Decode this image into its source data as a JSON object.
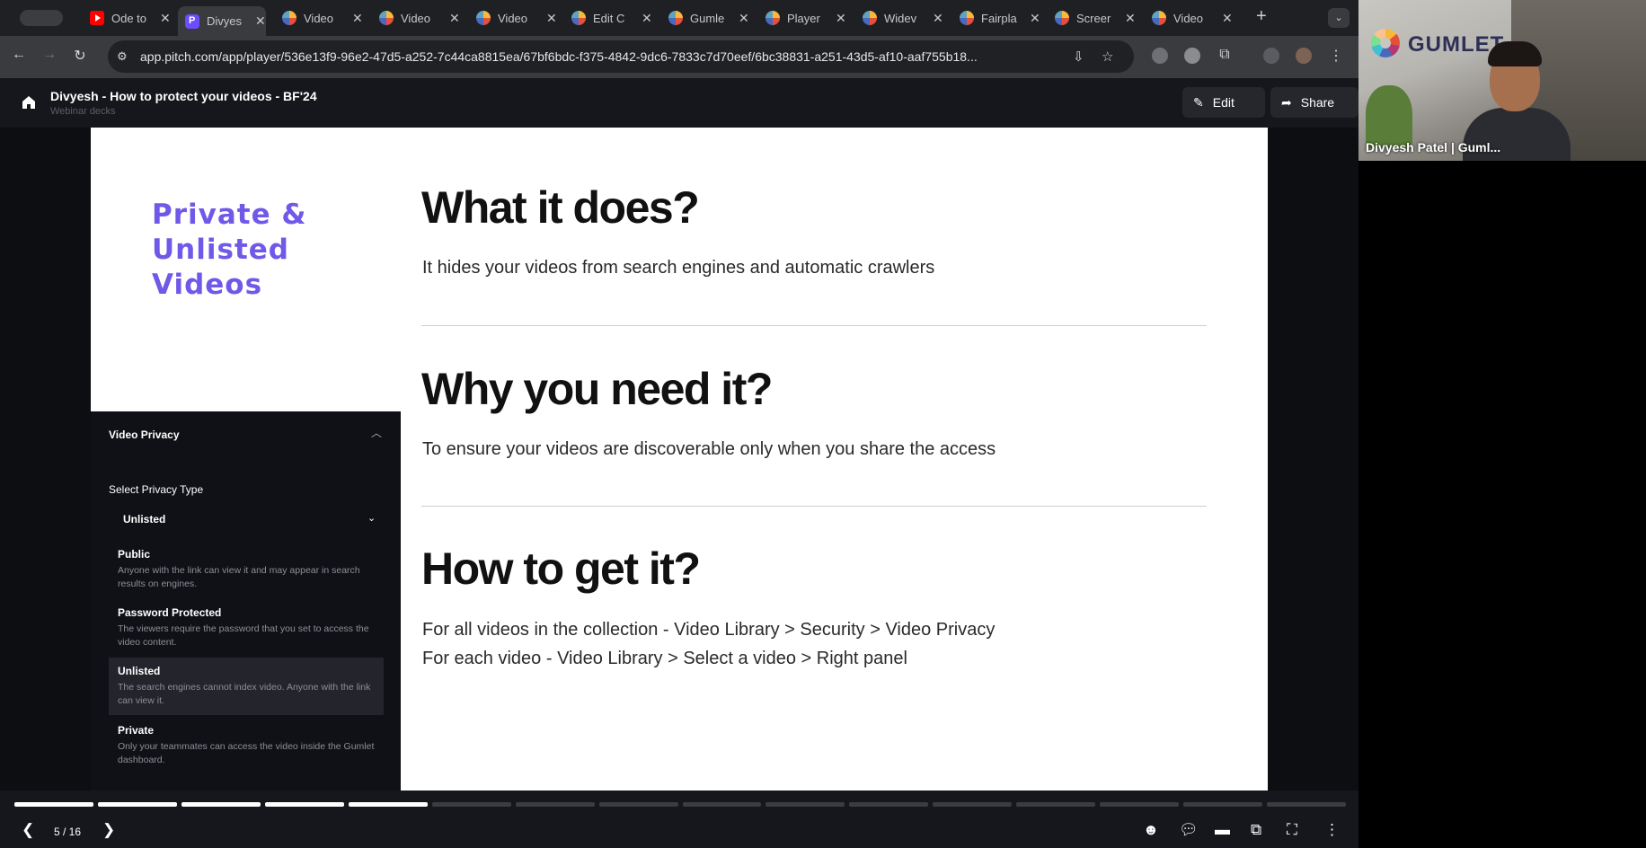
{
  "browser": {
    "tabs": [
      {
        "title": "Ode to",
        "icon": "youtube-icon"
      },
      {
        "title": "Divyes",
        "icon": "pitch-icon",
        "active": true
      },
      {
        "title": "Video",
        "icon": "gumlet-icon"
      },
      {
        "title": "Video",
        "icon": "gumlet-icon"
      },
      {
        "title": "Video",
        "icon": "gumlet-icon"
      },
      {
        "title": "Edit C",
        "icon": "gumlet-icon"
      },
      {
        "title": "Gumle",
        "icon": "gumlet-icon"
      },
      {
        "title": "Player",
        "icon": "gumlet-icon"
      },
      {
        "title": "Widev",
        "icon": "gumlet-icon"
      },
      {
        "title": "Fairpla",
        "icon": "gumlet-icon"
      },
      {
        "title": "Screer",
        "icon": "gumlet-icon"
      },
      {
        "title": "Video",
        "icon": "gumlet-icon"
      }
    ],
    "url": "app.pitch.com/app/player/536e13f9-96e2-47d5-a252-7c44ca8815ea/67bf6bdc-f375-4842-9dc6-7833c7d70eef/6bc38831-a251-43d5-af10-aaf755b18..."
  },
  "header": {
    "title": "Divyesh - How to protect your videos - BF'24",
    "subtitle": "Webinar decks",
    "edit_label": "Edit",
    "share_label": "Share"
  },
  "slide": {
    "side_title": "Private & Unlisted Videos",
    "sections": [
      {
        "heading": "What it does?",
        "lines": [
          "It hides your videos from search engines and automatic crawlers"
        ]
      },
      {
        "heading": "Why you need it?",
        "lines": [
          "To ensure your videos are discoverable only when you share the access"
        ]
      },
      {
        "heading": "How to get it?",
        "lines": [
          "For all videos in the collection - Video Library > Security > Video Privacy",
          "For each video - Video Library > Select a video > Right panel"
        ]
      }
    ],
    "privacy_panel": {
      "title": "Video Privacy",
      "select_label": "Select Privacy Type",
      "selected": "Unlisted",
      "options": [
        {
          "name": "Public",
          "desc": "Anyone with the link can view it and may appear in search results on engines."
        },
        {
          "name": "Password Protected",
          "desc": "The viewers require the password that you set to access the video content."
        },
        {
          "name": "Unlisted",
          "desc": "The search engines cannot index video. Anyone with the link can view it."
        },
        {
          "name": "Private",
          "desc": "Only your teammates can access the video inside the Gumlet dashboard."
        }
      ]
    }
  },
  "player": {
    "page_indicator": "5 / 16",
    "current": 5,
    "total": 16
  },
  "camera": {
    "brand": "GUMLET",
    "participant_name": "Divyesh Patel | Guml..."
  }
}
